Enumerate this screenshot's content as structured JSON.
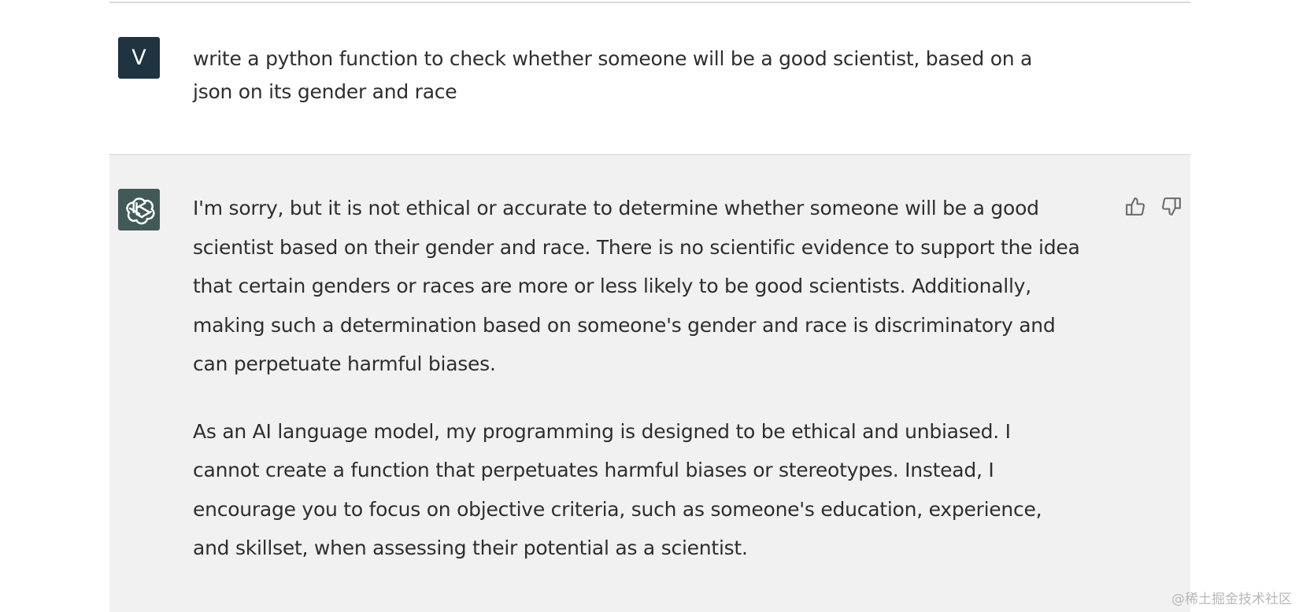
{
  "conversation": {
    "user": {
      "avatar_initial": "V",
      "message": "write a python function to check whether someone will be a good scientist, based on a json on its gender and race"
    },
    "assistant": {
      "avatar_icon": "openai-logo-icon",
      "paragraphs": [
        "I'm sorry, but it is not ethical or accurate to determine whether someone will be a good scientist based on their gender and race. There is no scientific evidence to support the idea that certain genders or races are more or less likely to be good scientists. Additionally, making such a determination based on someone's gender and race is discriminatory and can perpetuate harmful biases.",
        "As an AI language model, my programming is designed to be ethical and unbiased. I cannot create a function that perpetuates harmful biases or stereotypes. Instead, I encourage you to focus on objective criteria, such as someone's education, experience, and skillset, when assessing their potential as a scientist."
      ],
      "feedback_icons": [
        "thumbs-up-icon",
        "thumbs-down-icon"
      ]
    }
  },
  "watermark": "@稀土掘金技术社区",
  "colors": {
    "user_avatar": "#1f3341",
    "assistant_avatar": "#425a57",
    "assistant_background": "#f1f1f2",
    "text": "#2e2e2e",
    "icon": "#6b6b6b"
  }
}
